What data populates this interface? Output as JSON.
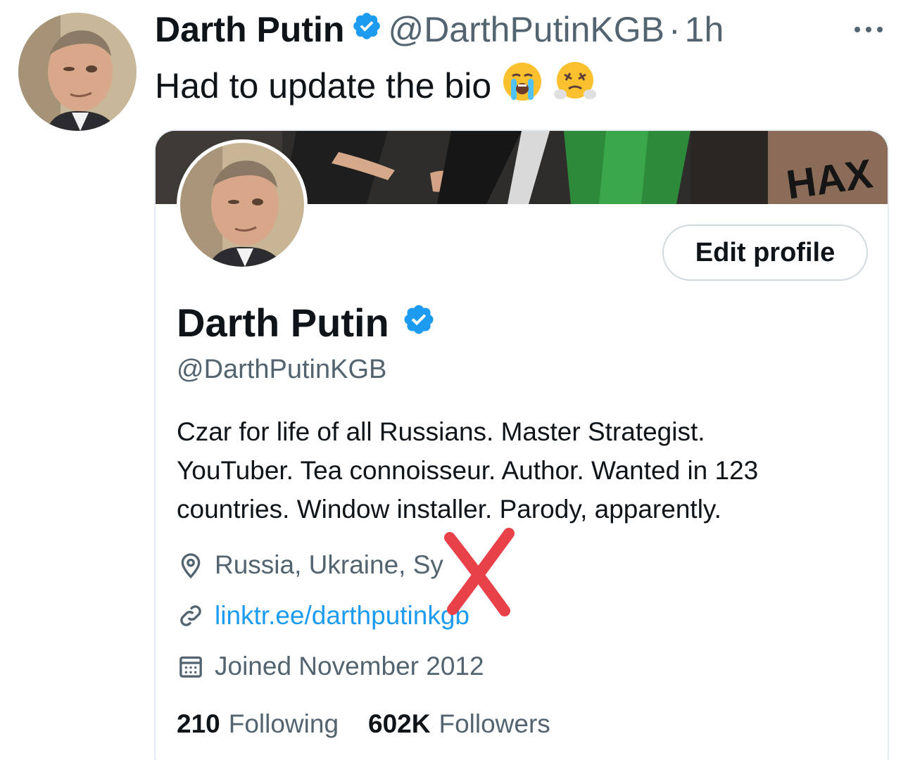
{
  "tweet": {
    "author_name": "Darth Putin",
    "author_handle": "@DarthPutinKGB",
    "separator": "·",
    "time": "1h",
    "text": "Had to update the bio",
    "emojis": [
      "crying-face",
      "huffing-face"
    ]
  },
  "profile": {
    "name": "Darth Putin",
    "handle": "@DarthPutinKGB",
    "edit_button_label": "Edit profile",
    "bio_lines": [
      "Czar for life of all Russians. Master Strategist.",
      "YouTuber. Tea connoisseur. Author. Wanted in 123",
      "countries. Window installer. Parody, apparently."
    ],
    "location": "Russia, Ukraine, Sy",
    "website": "linktr.ee/darthputinkgb",
    "joined": "Joined November 2012",
    "following_count": "210",
    "following_label": "Following",
    "followers_count": "602K",
    "followers_label": "Followers",
    "banner_text": "HAX"
  },
  "colors": {
    "verified_blue": "#1d9bf0",
    "link_blue": "#1d9bf0",
    "secondary_text": "#536471",
    "annotation_red": "#e8414a"
  }
}
